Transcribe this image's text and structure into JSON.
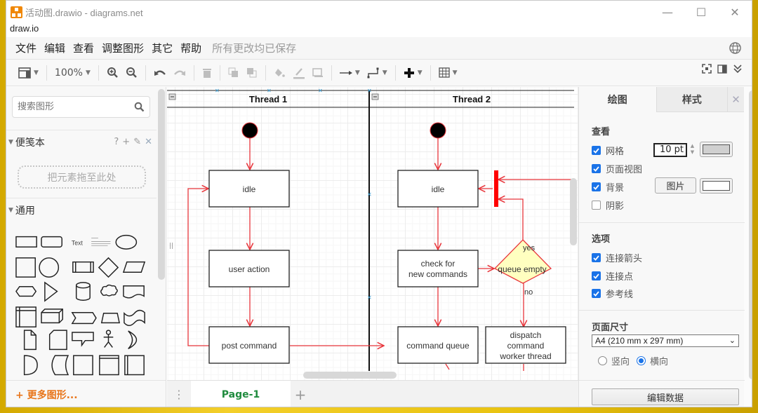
{
  "window": {
    "title": "活动图.drawio - diagrams.net",
    "brand": "draw.io",
    "controls": {
      "minimize": "—",
      "maximize": "☐",
      "close": "✕"
    }
  },
  "menubar": {
    "items": [
      "文件",
      "编辑",
      "查看",
      "调整图形",
      "其它",
      "帮助"
    ],
    "status": "所有更改均已保存"
  },
  "toolbar": {
    "zoom": "100%",
    "icons": [
      "view-panels-icon",
      "zoom-in-icon",
      "zoom-out-icon",
      "undo-icon",
      "redo-icon",
      "delete-icon",
      "to-front-icon",
      "to-back-icon",
      "fill-color-icon",
      "line-color-icon",
      "shadow-icon",
      "connection-icon",
      "waypoints-icon",
      "insert-icon",
      "table-icon",
      "fullscreen-icon",
      "format-panel-icon",
      "collapse-icon"
    ]
  },
  "sidebar": {
    "search_placeholder": "搜索图形",
    "scratchpad": {
      "title": "便笺本",
      "tools": [
        "?",
        "+",
        "✎",
        "✕"
      ],
      "dropzone": "把元素拖至此处"
    },
    "general": {
      "title": "通用"
    },
    "shape_text": "Text",
    "more_shapes": "+ 更多图形..."
  },
  "diagram": {
    "lanes": [
      {
        "title": "Thread 1"
      },
      {
        "title": "Thread 2"
      }
    ],
    "nodes": {
      "t1_idle": "idle",
      "t1_user_action": "user action",
      "t1_post_command": "post command",
      "t2_idle": "idle",
      "t2_check": [
        "check for",
        "new commands"
      ],
      "t2_queue_empty": "queue empty",
      "t2_command_queue": "command queue",
      "t2_dispatch": [
        "dispatch",
        "command",
        "worker thread"
      ]
    },
    "edge_labels": {
      "yes": "yes",
      "no": "no"
    },
    "colors": {
      "edge": "#e8353b",
      "decision_fill": "#ffffc0",
      "bar": "#ff0000"
    }
  },
  "pages": {
    "tabs": [
      "Page-1"
    ],
    "active": "Page-1",
    "add": "+"
  },
  "format_panel": {
    "tabs": [
      "绘图",
      "样式"
    ],
    "active_tab": "绘图",
    "close": "✕",
    "view": {
      "title": "查看",
      "grid": {
        "label": "网格",
        "checked": true,
        "size": "10 pt",
        "color": "#d0d0d0"
      },
      "page_view": {
        "label": "页面视图",
        "checked": true
      },
      "background": {
        "label": "背景",
        "checked": true,
        "image_button": "图片",
        "color": "#ffffff"
      },
      "shadow": {
        "label": "阴影",
        "checked": false
      }
    },
    "options": {
      "title": "选项",
      "connection_arrows": {
        "label": "连接箭头",
        "checked": true
      },
      "connection_points": {
        "label": "连接点",
        "checked": true
      },
      "guides": {
        "label": "参考线",
        "checked": true
      }
    },
    "page_size": {
      "title": "页面尺寸",
      "selected": "A4 (210 mm x 297 mm)",
      "portrait": "竖向",
      "landscape": "横向",
      "orientation": "landscape"
    },
    "edit_data_button": "编辑数据"
  }
}
